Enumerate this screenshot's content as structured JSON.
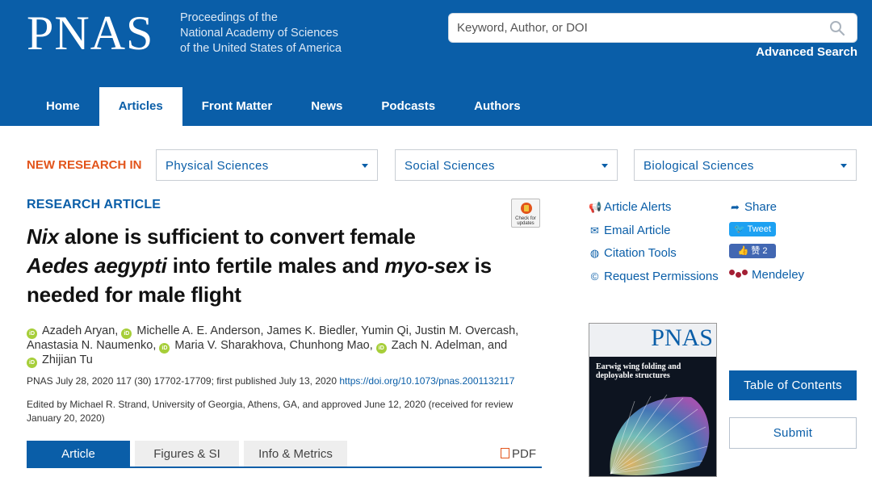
{
  "header": {
    "logo": "PNAS",
    "subtitle_lines": [
      "Proceedings of the",
      "National Academy of Sciences",
      "of the United States of America"
    ],
    "search_placeholder": "Keyword, Author, or DOI",
    "advanced_search": "Advanced Search"
  },
  "nav": {
    "items": [
      {
        "label": "Home"
      },
      {
        "label": "Articles",
        "active": true
      },
      {
        "label": "Front Matter"
      },
      {
        "label": "News"
      },
      {
        "label": "Podcasts"
      },
      {
        "label": "Authors"
      }
    ]
  },
  "new_research": {
    "label": "NEW RESEARCH IN",
    "selects": [
      "Physical Sciences",
      "Social Sciences",
      "Biological Sciences"
    ]
  },
  "article": {
    "type_label": "RESEARCH ARTICLE",
    "check_updates": "Check for updates",
    "title_parts": {
      "nix": "Nix",
      "part1": " alone is sufficient to convert female",
      "aedes": "Aedes aegypti",
      "part2": " into fertile males and ",
      "myosex": "myo-sex",
      "part3": " is",
      "part4": "needed for male flight"
    },
    "authors": {
      "a1": "Azadeh Aryan,",
      "a2": "Michelle A. E. Anderson, James K. Biedler, Yumin Qi, Justin M. Overcash,",
      "a3": "Anastasia N. Naumenko,",
      "a4": "Maria V. Sharakhova, Chunhong Mao,",
      "a5": "Zach N. Adelman, and",
      "a6": "Zhijian Tu",
      "orcid_badge": "iD"
    },
    "citation": "PNAS July 28, 2020 117 (30) 17702-17709; first published July 13, 2020 ",
    "doi": "https://doi.org/10.1073/pnas.2001132117",
    "edited_by": "Edited by Michael R. Strand, University of Georgia, Athens, GA, and approved June 12, 2020 (received for review January 20, 2020)",
    "tabs": [
      "Article",
      "Figures & SI",
      "Info & Metrics"
    ],
    "pdf": "PDF"
  },
  "tools": {
    "article_alerts": "Article Alerts",
    "email_article": "Email Article",
    "citation_tools": "Citation Tools",
    "request_permissions": "Request Permissions",
    "share": "Share",
    "tweet": "Tweet",
    "like": "赞 2",
    "mendeley": "Mendeley"
  },
  "cover": {
    "logo": "PNAS",
    "headline": "Earwig wing folding and deployable structures"
  },
  "sidebar": {
    "toc": "Table of Contents",
    "submit": "Submit"
  },
  "colors": {
    "brand_blue": "#0a5ea8",
    "accent_orange": "#e2541b",
    "orcid_green": "#a6ce39"
  }
}
